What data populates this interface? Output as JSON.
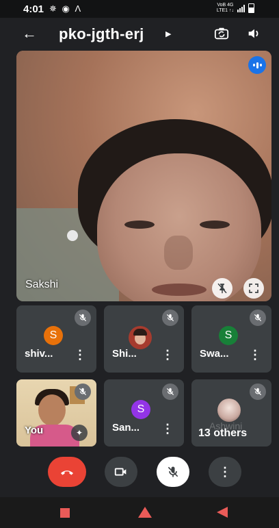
{
  "status_bar": {
    "time": "4:01",
    "left_icons": "✵ ◉ Ʌ",
    "net_top": "VoB 4G",
    "net_bottom": "LTE1 ↑↓"
  },
  "header": {
    "meeting_code": "pko-jgth-erj",
    "back_icon": "arrow-back-icon",
    "switch_camera_icon": "switch-camera-icon",
    "audio_output_icon": "speaker-icon"
  },
  "main_tile": {
    "name": "Sakshi",
    "pin_icon": "pin-off-icon",
    "fullscreen_icon": "fullscreen-icon",
    "speaking_icon": "audio-level-icon"
  },
  "tiles": [
    {
      "name": "shiv...",
      "avatar_letter": "S",
      "avatar_color": "#e8710a",
      "muted": true
    },
    {
      "name": "Shi...",
      "avatar_letter": "",
      "avatar_color": "#a63b2e",
      "muted": true
    },
    {
      "name": "Swa...",
      "avatar_letter": "S",
      "avatar_color": "#188038",
      "muted": true
    },
    {
      "name": "You",
      "muted": true
    },
    {
      "name": "San...",
      "avatar_letter": "S",
      "avatar_color": "#9334e6",
      "muted": true
    },
    {
      "name": "13 others",
      "faded_name": "Ashwini",
      "muted": true
    }
  ],
  "controls": {
    "end_call_icon": "call-end-icon",
    "camera_icon": "videocam-icon",
    "mic_icon": "mic-off-icon",
    "more_icon": "more-vert-icon"
  },
  "colors": {
    "background": "#202124",
    "tile": "#3c4043",
    "end_call": "#ea4335",
    "accent_blue": "#1a73e8",
    "nav": "#ea5b58"
  }
}
